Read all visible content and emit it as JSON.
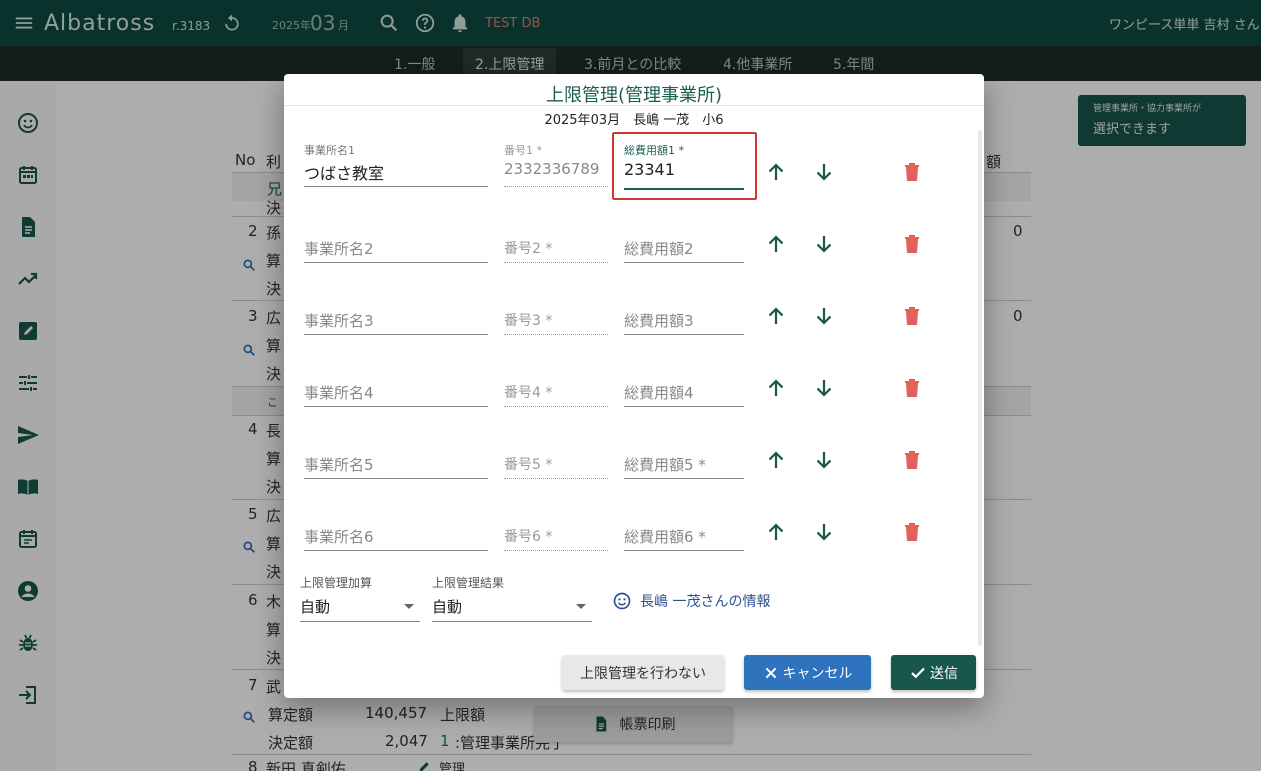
{
  "header": {
    "app_name": "Albatross",
    "version": "r.3183",
    "year_label": "2025年",
    "month": "03",
    "month_suffix": "月",
    "db_name": "TEST DB",
    "user_label": "ワンピース単単 吉村 さん"
  },
  "tabs": [
    "1.一般",
    "2.上限管理",
    "3.前月との比較",
    "4.他事業所",
    "5.年間"
  ],
  "active_tab": "2.上限管理",
  "sidebar_icons": [
    "smiley-icon",
    "calendar-icon",
    "document-icon",
    "trending-up-icon",
    "edit-icon",
    "tune-icon",
    "send-icon",
    "book-icon",
    "event-icon",
    "account-circle-icon",
    "bug-icon",
    "login-icon"
  ],
  "background": {
    "col_no": "No",
    "col_name": "利",
    "col_amount": "額",
    "group1": "兄",
    "row1_kettei": "決",
    "rows": [
      {
        "no": "2",
        "name": "孫",
        "sub1": "算",
        "sub2": "決",
        "amount": "0"
      },
      {
        "no": "3",
        "name": "広",
        "sub1": "算",
        "sub2": "決",
        "amount": "0"
      },
      {
        "no": "4",
        "name": "長",
        "sub1": "算",
        "sub2": "決",
        "amount": ""
      },
      {
        "no": "5",
        "name": "広",
        "sub1": "算",
        "sub2": "決",
        "amount": ""
      },
      {
        "no": "6",
        "name": "木",
        "sub1": "算",
        "sub2": "決",
        "amount": ""
      }
    ],
    "group2": "こ",
    "row7": {
      "no": "7",
      "name": "武",
      "santei_label": "算定額",
      "santei_value": "140,457",
      "limit_label": "上限額",
      "kettei_label": "決定額",
      "kettei_value": "2,047",
      "manage_no": "1",
      "manage_text": ":管理事業所完了"
    },
    "row8": {
      "no": "8",
      "name": "新田 真剣佑",
      "tag": "管理"
    },
    "print_button": "帳票印刷"
  },
  "tooltip": {
    "line1": "管理事業所・協力事業所が",
    "line2": "選択できます"
  },
  "dialog": {
    "title": "上限管理(管理事業所)",
    "subtitle": "2025年03月　長嶋 一茂　小6",
    "rows": [
      {
        "name_label": "事業所名1",
        "name_value": "つばさ教室",
        "num_label": "番号1 *",
        "num_value": "2332336789",
        "cost_label": "総費用額1 *",
        "cost_value": "23341"
      },
      {
        "name_label": "事業所名2",
        "num_label": "番号2 *",
        "cost_label": "総費用額2"
      },
      {
        "name_label": "事業所名3",
        "num_label": "番号3 *",
        "cost_label": "総費用額3"
      },
      {
        "name_label": "事業所名4",
        "num_label": "番号4 *",
        "cost_label": "総費用額4"
      },
      {
        "name_label": "事業所名5",
        "num_label": "番号5 *",
        "cost_label": "総費用額5 *"
      },
      {
        "name_label": "事業所名6",
        "num_label": "番号6 *",
        "cost_label": "総費用額6 *"
      }
    ],
    "kasan_label": "上限管理加算",
    "kasan_value": "自動",
    "kekka_label": "上限管理結果",
    "kekka_value": "自動",
    "info_link": "長嶋 一茂さんの情報",
    "btn_no_manage": "上限管理を行わない",
    "btn_cancel": "キャンセル",
    "btn_send": "送信"
  },
  "colors": {
    "brand_dark": "#0f4a41",
    "accent_green": "#1b5e53",
    "delete_red": "#e0605a",
    "cancel_blue": "#2f72bd",
    "highlight_red": "#d03a32"
  }
}
